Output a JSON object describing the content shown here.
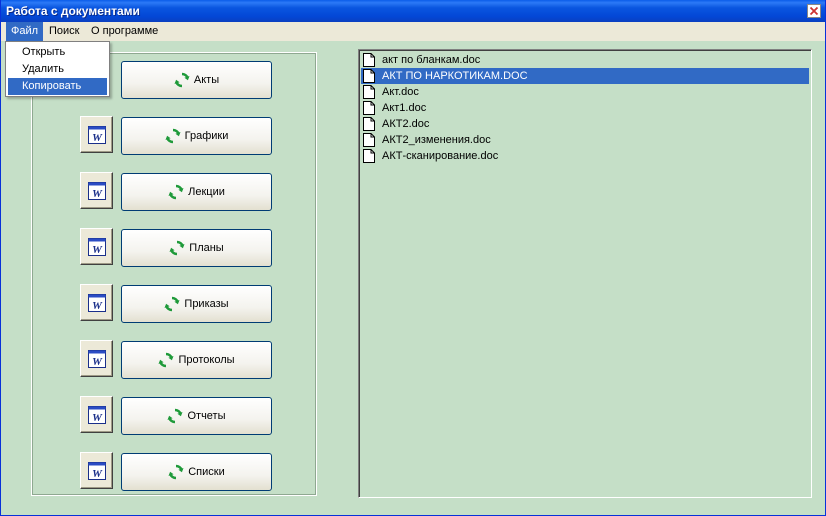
{
  "window": {
    "title": "Работа с документами"
  },
  "menubar": {
    "items": [
      "Файл",
      "Поиск",
      "О программе"
    ]
  },
  "file_menu": {
    "items": [
      "Открыть",
      "Удалить",
      "Копировать"
    ],
    "selected": "Копировать"
  },
  "categories": [
    {
      "label": "Акты",
      "word_icon": "word-doc-icon"
    },
    {
      "label": "Графики",
      "word_icon": "word-doc-icon"
    },
    {
      "label": "Лекции",
      "word_icon": "word-doc-icon"
    },
    {
      "label": "Планы",
      "word_icon": "word-doc-icon"
    },
    {
      "label": "Приказы",
      "word_icon": "word-doc-icon"
    },
    {
      "label": "Протоколы",
      "word_icon": "word-doc-icon"
    },
    {
      "label": "Отчеты",
      "word_icon": "word-doc-icon"
    },
    {
      "label": "Списки",
      "word_icon": "word-doc-icon"
    }
  ],
  "files": [
    "акт по бланкам.doc",
    "АКТ ПО НАРКОТИКАМ.DOC",
    "Акт.doc",
    "Акт1.doc",
    "АКТ2.doc",
    "АКТ2_изменения.doc",
    "АКТ-сканирование.doc"
  ],
  "selected_file": "АКТ ПО НАРКОТИКАМ.DOC",
  "colors": {
    "background": "#c5dfc7",
    "titlebar": "#0347d6",
    "selection": "#316ac5",
    "menubar": "#ece9d8",
    "refresh_icon": "#1f9a3a"
  }
}
